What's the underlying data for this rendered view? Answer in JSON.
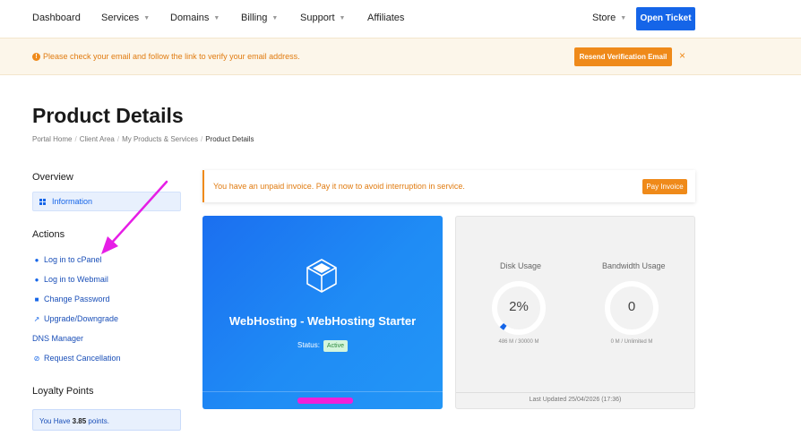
{
  "nav": {
    "items": [
      {
        "label": "Dashboard",
        "caret": false
      },
      {
        "label": "Services",
        "caret": true
      },
      {
        "label": "Domains",
        "caret": true
      },
      {
        "label": "Billing",
        "caret": true
      },
      {
        "label": "Support",
        "caret": true
      },
      {
        "label": "Affiliates",
        "caret": false
      }
    ],
    "store": "Store",
    "open_ticket": "Open Ticket"
  },
  "verify_banner": {
    "message": "Please check your email and follow the link to verify your email address.",
    "resend_button": "Resend Verification Email",
    "close": "×"
  },
  "page_title": "Product Details",
  "breadcrumb": [
    "Portal Home",
    "Client Area",
    "My Products & Services",
    "Product Details"
  ],
  "sidebar": {
    "overview_heading": "Overview",
    "information": "Information",
    "actions_heading": "Actions",
    "actions": [
      {
        "label": "Log in to cPanel",
        "icon": "user-icon"
      },
      {
        "label": "Log in to Webmail",
        "icon": "user-icon"
      },
      {
        "label": "Change Password",
        "icon": "lock-icon"
      },
      {
        "label": "Upgrade/Downgrade",
        "icon": "external-link-icon"
      },
      {
        "label": "DNS Manager",
        "icon": ""
      },
      {
        "label": "Request Cancellation",
        "icon": "ban-icon"
      }
    ],
    "loyalty_heading": "Loyalty Points",
    "loyalty_prefix": "You Have ",
    "loyalty_points": "3.85",
    "loyalty_suffix": " points."
  },
  "unpaid_alert": {
    "message": "You have an unpaid invoice. Pay it now to avoid interruption in service.",
    "button": "Pay Invoice"
  },
  "product": {
    "name": "WebHosting - WebHosting Starter",
    "status_label": "Status:",
    "status_value": "Active"
  },
  "usage": {
    "disk": {
      "label": "Disk Usage",
      "value": "2%",
      "detail": "486 M / 30000 M",
      "fraction": 0.02
    },
    "bandwidth": {
      "label": "Bandwidth Usage",
      "value": "0",
      "detail": "0 M / Unlimited M",
      "fraction": 0
    },
    "last_updated": "Last Updated 25/04/2026 (17:36)"
  },
  "colors": {
    "primary": "#1565e8",
    "warning": "#ef8a1a",
    "annotation": "#e61ee6"
  }
}
